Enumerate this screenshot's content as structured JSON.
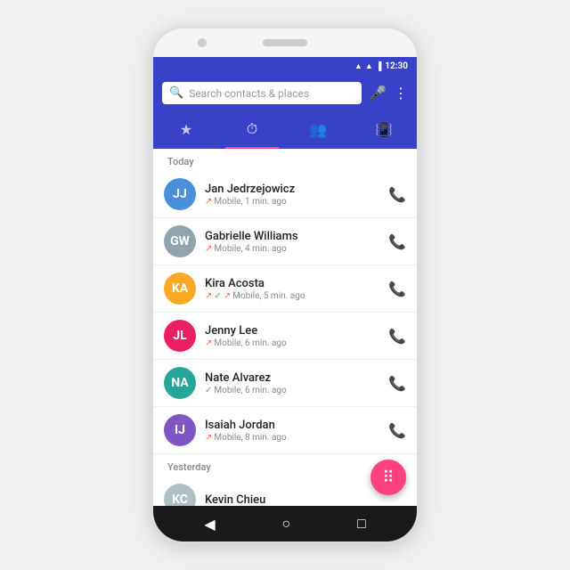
{
  "status_bar": {
    "time": "12:30",
    "signal_icon": "▲",
    "wifi_icon": "▲",
    "battery_icon": "▐"
  },
  "search": {
    "placeholder": "Search contacts & places"
  },
  "tabs": [
    {
      "id": "favorites",
      "icon": "★",
      "active": false
    },
    {
      "id": "recent",
      "icon": "⏱",
      "active": true
    },
    {
      "id": "contacts",
      "icon": "👥",
      "active": false
    },
    {
      "id": "voicemail",
      "icon": "📳",
      "active": false
    }
  ],
  "sections": [
    {
      "label": "Today",
      "contacts": [
        {
          "name": "Jan Jedrzejowicz",
          "detail": "↗ Mobile, 1 min. ago",
          "arrow_type": "out",
          "avatar_initials": "JJ",
          "avatar_color": "av-blue"
        },
        {
          "name": "Gabrielle Williams",
          "detail": "↗ Mobile, 4 min. ago",
          "arrow_type": "out",
          "avatar_initials": "GW",
          "avatar_color": "av-gray"
        },
        {
          "name": "Kira Acosta",
          "detail": "↗ ✓ ↗ Mobile, 5 min. ago",
          "arrow_type": "mixed",
          "avatar_initials": "KA",
          "avatar_color": "av-yellow"
        },
        {
          "name": "Jenny Lee",
          "detail": "↗ Mobile, 6 min. ago",
          "arrow_type": "out",
          "avatar_initials": "JL",
          "avatar_color": "av-pink"
        },
        {
          "name": "Nate Alvarez",
          "detail": "✓ Mobile, 6 min. ago",
          "arrow_type": "in",
          "avatar_initials": "NA",
          "avatar_color": "av-teal"
        },
        {
          "name": "Isaiah Jordan",
          "detail": "↗ Mobile, 8 min. ago",
          "arrow_type": "out",
          "avatar_initials": "IJ",
          "avatar_color": "av-purple"
        }
      ]
    },
    {
      "label": "Yesterday",
      "contacts": [
        {
          "name": "Kevin Chieu",
          "detail": "",
          "partial": true,
          "avatar_initials": "KC",
          "avatar_color": "av-partial"
        }
      ]
    }
  ],
  "fab": {
    "icon": "⠿",
    "label": "dialpad"
  },
  "nav": {
    "back": "◀",
    "home": "○",
    "recents": "□"
  }
}
